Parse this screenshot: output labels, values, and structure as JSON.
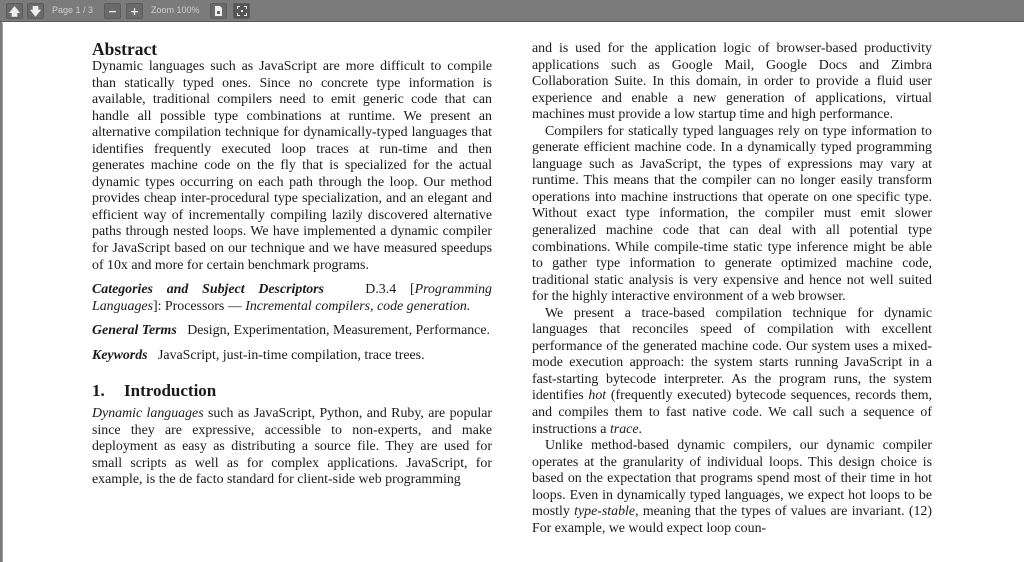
{
  "toolbar": {
    "prev_page_icon": "arrow-up-icon",
    "next_page_icon": "arrow-down-icon",
    "page_label": "Page 1 / 3",
    "zoom_out_label": "−",
    "zoom_in_label": "+",
    "zoom_label": "Zoom 100%",
    "download_icon": "document-icon",
    "fullscreen_icon": "fullscreen-icon"
  },
  "paper": {
    "abstract_heading": "Abstract",
    "abstract_text": "Dynamic languages such as JavaScript are more difficult to compile than statically typed ones. Since no concrete type information is available, traditional compilers need to emit generic code that can handle all possible type combinations at runtime. We present an alternative compilation technique for dynamically-typed languages that identifies frequently executed loop traces at run-time and then generates machine code on the fly that is specialized for the actual dynamic types occurring on each path through the loop. Our method provides cheap inter-procedural type specialization, and an elegant and efficient way of incrementally compiling lazily discovered alternative paths through nested loops. We have implemented a dynamic compiler for JavaScript based on our technique and we have measured speedups of 10x and more for certain benchmark programs.",
    "categories_label": "Categories and Subject Descriptors",
    "categories_code": "D.3.4 [",
    "categories_italic1": "Programming Languages",
    "categories_mid": "]: Processors — ",
    "categories_italic2": "Incremental compilers, code generation.",
    "general_terms_label": "General Terms",
    "general_terms_text": "Design, Experimentation, Measurement, Performance.",
    "keywords_label": "Keywords",
    "keywords_text": "JavaScript, just-in-time compilation, trace trees.",
    "intro_number": "1.",
    "intro_heading": "Introduction",
    "intro_p1_italic": "Dynamic languages",
    "intro_p1_text": " such as JavaScript, Python, and Ruby, are popular since they are expressive, accessible to non-experts, and make deployment as easy as distributing a source file. They are used for small scripts as well as for complex applications. JavaScript, for example, is the de facto standard for client-side web programming",
    "right_p1": "and is used for the application logic of browser-based productivity applications such as Google Mail, Google Docs and Zimbra Collaboration Suite. In this domain, in order to provide a fluid user experience and enable a new generation of applications, virtual machines must provide a low startup time and high performance.",
    "right_p2": "Compilers for statically typed languages rely on type information to generate efficient machine code. In a dynamically typed programming language such as JavaScript, the types of expressions may vary at runtime. This means that the compiler can no longer easily transform operations into machine instructions that operate on one specific type. Without exact type information, the compiler must emit slower generalized machine code that can deal with all potential type combinations. While compile-time static type inference might be able to gather type information to generate optimized machine code, traditional static analysis is very expensive and hence not well suited for the highly interactive environment of a web browser.",
    "right_p3_a": "We present a trace-based compilation technique for dynamic languages that reconciles speed of compilation with excellent performance of the generated machine code. Our system uses a mixed-mode execution approach: the system starts running JavaScript in a fast-starting bytecode interpreter. As the program runs, the system identifies ",
    "right_p3_hot": "hot",
    "right_p3_b": " (frequently executed) bytecode sequences, records them, and compiles them to fast native code. We call such a sequence of instructions a ",
    "right_p3_trace": "trace",
    "right_p3_c": ".",
    "right_p4_a": "Unlike method-based dynamic compilers, our dynamic compiler operates at the granularity of individual loops. This design choice is based on the expectation that programs spend most of their time in hot loops. Even in dynamically typed languages, we expect hot loops to be mostly ",
    "right_p4_italic": "type-stable",
    "right_p4_b": ", meaning that the types of values are invariant. (12) For example, we would expect loop coun-"
  }
}
